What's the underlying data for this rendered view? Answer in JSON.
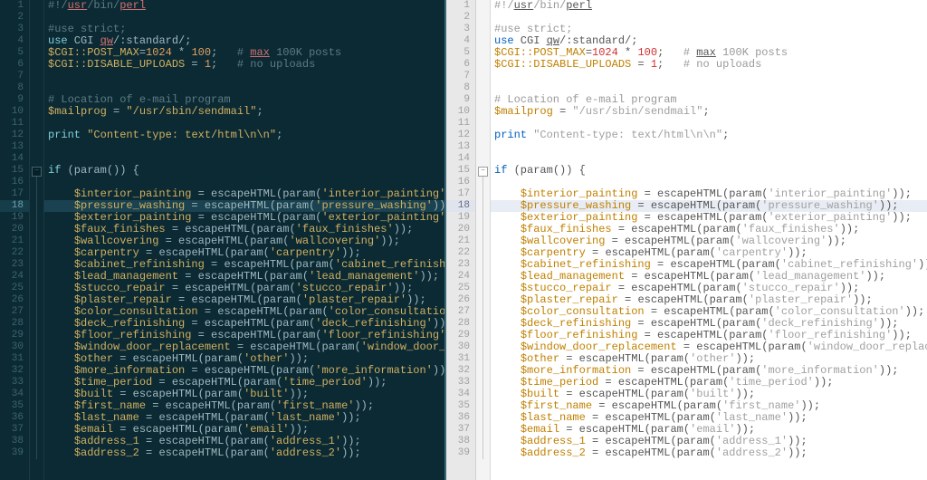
{
  "left": {
    "activeLine": 18
  },
  "right": {
    "activeLine": 18
  },
  "lines": [
    {
      "n": 1,
      "fold": "",
      "tokens": [
        [
          "c",
          "#!/"
        ],
        [
          "red",
          "usr"
        ],
        [
          "c",
          "/bin/"
        ],
        [
          "red",
          "perl"
        ]
      ]
    },
    {
      "n": 2,
      "fold": "",
      "tokens": []
    },
    {
      "n": 3,
      "fold": "",
      "tokens": [
        [
          "c",
          "#use strict;"
        ]
      ]
    },
    {
      "n": 4,
      "fold": "",
      "tokens": [
        [
          "k",
          "use"
        ],
        [
          "f",
          " CGI "
        ],
        [
          "red",
          "qw"
        ],
        [
          "f",
          "/:standard/;"
        ]
      ]
    },
    {
      "n": 5,
      "fold": "",
      "tokens": [
        [
          "v",
          "$CGI::POST_MAX"
        ],
        [
          "op",
          "="
        ],
        [
          "n",
          "1024"
        ],
        [
          "op",
          " * "
        ],
        [
          "n",
          "100"
        ],
        [
          "f",
          ";   "
        ],
        [
          "c",
          "# "
        ],
        [
          "red",
          "max"
        ],
        [
          "c",
          " 100K posts"
        ]
      ]
    },
    {
      "n": 6,
      "fold": "",
      "tokens": [
        [
          "v",
          "$CGI::DISABLE_UPLOADS"
        ],
        [
          "op",
          " = "
        ],
        [
          "n",
          "1"
        ],
        [
          "f",
          ";   "
        ],
        [
          "c",
          "# no uploads"
        ]
      ]
    },
    {
      "n": 7,
      "fold": "",
      "tokens": []
    },
    {
      "n": 8,
      "fold": "",
      "tokens": []
    },
    {
      "n": 9,
      "fold": "",
      "tokens": [
        [
          "c",
          "# Location of e-mail program"
        ]
      ]
    },
    {
      "n": 10,
      "fold": "",
      "tokens": [
        [
          "v",
          "$mailprog"
        ],
        [
          "op",
          " = "
        ],
        [
          "s",
          "\"/usr/sbin/sendmail\""
        ],
        [
          "f",
          ";"
        ]
      ]
    },
    {
      "n": 11,
      "fold": "",
      "tokens": []
    },
    {
      "n": 12,
      "fold": "",
      "tokens": [
        [
          "k",
          "print"
        ],
        [
          "f",
          " "
        ],
        [
          "s",
          "\"Content-type: text/html\\n\\n\""
        ],
        [
          "f",
          ";"
        ]
      ]
    },
    {
      "n": 13,
      "fold": "",
      "tokens": []
    },
    {
      "n": 14,
      "fold": "",
      "tokens": []
    },
    {
      "n": 15,
      "fold": "box",
      "tokens": [
        [
          "k",
          "if"
        ],
        [
          "f",
          " (param()) {"
        ]
      ]
    },
    {
      "n": 16,
      "fold": "line",
      "tokens": []
    },
    {
      "n": 17,
      "fold": "line",
      "indent": 1,
      "tokens": [
        [
          "v",
          "$interior_painting"
        ],
        [
          "op",
          " = "
        ],
        [
          "f",
          "escapeHTML(param("
        ],
        [
          "s",
          "'interior_painting'"
        ],
        [
          "f",
          "));"
        ]
      ]
    },
    {
      "n": 18,
      "fold": "line",
      "indent": 1,
      "hl": true,
      "tokens": [
        [
          "v",
          "$pressure_washing"
        ],
        [
          "op",
          " = "
        ],
        [
          "f",
          "escapeHTML(param("
        ],
        [
          "s",
          "'pressure_washing'"
        ],
        [
          "f",
          "));"
        ]
      ]
    },
    {
      "n": 19,
      "fold": "line",
      "indent": 1,
      "tokens": [
        [
          "v",
          "$exterior_painting"
        ],
        [
          "op",
          " = "
        ],
        [
          "f",
          "escapeHTML(param("
        ],
        [
          "s",
          "'exterior_painting'"
        ],
        [
          "f",
          "));"
        ]
      ]
    },
    {
      "n": 20,
      "fold": "line",
      "indent": 1,
      "tokens": [
        [
          "v",
          "$faux_finishes"
        ],
        [
          "op",
          " = "
        ],
        [
          "f",
          "escapeHTML(param("
        ],
        [
          "s",
          "'faux_finishes'"
        ],
        [
          "f",
          "));"
        ]
      ]
    },
    {
      "n": 21,
      "fold": "line",
      "indent": 1,
      "tokens": [
        [
          "v",
          "$wallcovering"
        ],
        [
          "op",
          " = "
        ],
        [
          "f",
          "escapeHTML(param("
        ],
        [
          "s",
          "'wallcovering'"
        ],
        [
          "f",
          "));"
        ]
      ]
    },
    {
      "n": 22,
      "fold": "line",
      "indent": 1,
      "tokens": [
        [
          "v",
          "$carpentry"
        ],
        [
          "op",
          " = "
        ],
        [
          "f",
          "escapeHTML(param("
        ],
        [
          "s",
          "'carpentry'"
        ],
        [
          "f",
          "));"
        ]
      ]
    },
    {
      "n": 23,
      "fold": "line",
      "indent": 1,
      "tokens": [
        [
          "v",
          "$cabinet_refinishing"
        ],
        [
          "op",
          " = "
        ],
        [
          "f",
          "escapeHTML(param("
        ],
        [
          "s",
          "'cabinet_refinishing'"
        ],
        [
          "f",
          "));"
        ]
      ]
    },
    {
      "n": 24,
      "fold": "line",
      "indent": 1,
      "tokens": [
        [
          "v",
          "$lead_management"
        ],
        [
          "op",
          " = "
        ],
        [
          "f",
          "escapeHTML(param("
        ],
        [
          "s",
          "'lead_management'"
        ],
        [
          "f",
          "));"
        ]
      ]
    },
    {
      "n": 25,
      "fold": "line",
      "indent": 1,
      "tokens": [
        [
          "v",
          "$stucco_repair"
        ],
        [
          "op",
          " = "
        ],
        [
          "f",
          "escapeHTML(param("
        ],
        [
          "s",
          "'stucco_repair'"
        ],
        [
          "f",
          "));"
        ]
      ]
    },
    {
      "n": 26,
      "fold": "line",
      "indent": 1,
      "tokens": [
        [
          "v",
          "$plaster_repair"
        ],
        [
          "op",
          " = "
        ],
        [
          "f",
          "escapeHTML(param("
        ],
        [
          "s",
          "'plaster_repair'"
        ],
        [
          "f",
          "));"
        ]
      ]
    },
    {
      "n": 27,
      "fold": "line",
      "indent": 1,
      "tokens": [
        [
          "v",
          "$color_consultation"
        ],
        [
          "op",
          " = "
        ],
        [
          "f",
          "escapeHTML(param("
        ],
        [
          "s",
          "'color_consultation'"
        ],
        [
          "f",
          "));"
        ]
      ]
    },
    {
      "n": 28,
      "fold": "line",
      "indent": 1,
      "tokens": [
        [
          "v",
          "$deck_refinishing"
        ],
        [
          "op",
          " = "
        ],
        [
          "f",
          "escapeHTML(param("
        ],
        [
          "s",
          "'deck_refinishing'"
        ],
        [
          "f",
          "));"
        ]
      ]
    },
    {
      "n": 29,
      "fold": "line",
      "indent": 1,
      "tokens": [
        [
          "v",
          "$floor_refinishing"
        ],
        [
          "op",
          " = "
        ],
        [
          "f",
          "escapeHTML(param("
        ],
        [
          "s",
          "'floor_refinishing'"
        ],
        [
          "f",
          "));"
        ]
      ]
    },
    {
      "n": 30,
      "fold": "line",
      "indent": 1,
      "tokens": [
        [
          "v",
          "$window_door_replacement"
        ],
        [
          "op",
          " = "
        ],
        [
          "f",
          "escapeHTML(param("
        ],
        [
          "s",
          "'window_door_replacement'"
        ],
        [
          "f",
          "));"
        ]
      ]
    },
    {
      "n": 31,
      "fold": "line",
      "indent": 1,
      "tokens": [
        [
          "v",
          "$other"
        ],
        [
          "op",
          " = "
        ],
        [
          "f",
          "escapeHTML(param("
        ],
        [
          "s",
          "'other'"
        ],
        [
          "f",
          "));"
        ]
      ]
    },
    {
      "n": 32,
      "fold": "line",
      "indent": 1,
      "tokens": [
        [
          "v",
          "$more_information"
        ],
        [
          "op",
          " = "
        ],
        [
          "f",
          "escapeHTML(param("
        ],
        [
          "s",
          "'more_information'"
        ],
        [
          "f",
          "));"
        ]
      ]
    },
    {
      "n": 33,
      "fold": "line",
      "indent": 1,
      "tokens": [
        [
          "v",
          "$time_period"
        ],
        [
          "op",
          " = "
        ],
        [
          "f",
          "escapeHTML(param("
        ],
        [
          "s",
          "'time_period'"
        ],
        [
          "f",
          "));"
        ]
      ]
    },
    {
      "n": 34,
      "fold": "line",
      "indent": 1,
      "tokens": [
        [
          "v",
          "$built"
        ],
        [
          "op",
          " = "
        ],
        [
          "f",
          "escapeHTML(param("
        ],
        [
          "s",
          "'built'"
        ],
        [
          "f",
          "));"
        ]
      ]
    },
    {
      "n": 35,
      "fold": "line",
      "indent": 1,
      "tokens": [
        [
          "v",
          "$first_name"
        ],
        [
          "op",
          " = "
        ],
        [
          "f",
          "escapeHTML(param("
        ],
        [
          "s",
          "'first_name'"
        ],
        [
          "f",
          "));"
        ]
      ]
    },
    {
      "n": 36,
      "fold": "line",
      "indent": 1,
      "tokens": [
        [
          "v",
          "$last_name"
        ],
        [
          "op",
          " = "
        ],
        [
          "f",
          "escapeHTML(param("
        ],
        [
          "s",
          "'last_name'"
        ],
        [
          "f",
          "));"
        ]
      ]
    },
    {
      "n": 37,
      "fold": "line",
      "indent": 1,
      "tokens": [
        [
          "v",
          "$email"
        ],
        [
          "op",
          " = "
        ],
        [
          "f",
          "escapeHTML(param("
        ],
        [
          "s",
          "'email'"
        ],
        [
          "f",
          "));"
        ]
      ]
    },
    {
      "n": 38,
      "fold": "line",
      "indent": 1,
      "tokens": [
        [
          "v",
          "$address_1"
        ],
        [
          "op",
          " = "
        ],
        [
          "f",
          "escapeHTML(param("
        ],
        [
          "s",
          "'address_1'"
        ],
        [
          "f",
          "));"
        ]
      ]
    },
    {
      "n": 39,
      "fold": "line",
      "indent": 1,
      "tokens": [
        [
          "v",
          "$address_2"
        ],
        [
          "op",
          " = "
        ],
        [
          "f",
          "escapeHTML(param("
        ],
        [
          "s",
          "'address_2'"
        ],
        [
          "f",
          "));"
        ]
      ]
    }
  ],
  "right_overrides": {
    "1": [
      [
        "c",
        "#!/"
      ],
      [
        "u",
        "usr"
      ],
      [
        "c",
        "/bin/"
      ],
      [
        "u",
        "perl"
      ]
    ],
    "4": [
      [
        "k",
        "use"
      ],
      [
        "f",
        " CGI "
      ],
      [
        "u",
        "qw"
      ],
      [
        "f",
        "/:standard/;"
      ]
    ],
    "5": [
      [
        "v",
        "$CGI::POST_MAX"
      ],
      [
        "f",
        "="
      ],
      [
        "n",
        "1024"
      ],
      [
        "f",
        " * "
      ],
      [
        "n",
        "100"
      ],
      [
        "f",
        ";   "
      ],
      [
        "c",
        "# "
      ],
      [
        "u",
        "max"
      ],
      [
        "c",
        " 100K posts"
      ]
    ]
  }
}
